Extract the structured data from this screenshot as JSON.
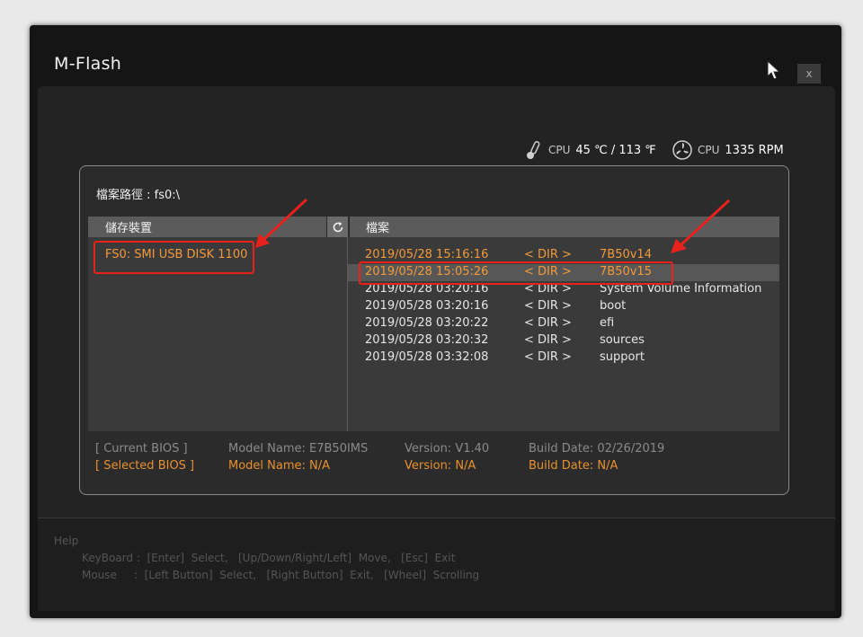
{
  "window": {
    "title": "M-Flash",
    "close_label": "x"
  },
  "status": {
    "cpu_temp_label": "CPU",
    "cpu_temp_value": "45 ℃ / 113 ℉",
    "cpu_fan_label": "CPU",
    "cpu_fan_value": "1335 RPM",
    "icons": [
      "thermometer-icon",
      "fan-icon"
    ]
  },
  "browser": {
    "path_label": "檔案路徑 : fs0:\\",
    "storage_header": "儲存裝置",
    "files_header": "檔案",
    "devices": [
      "FS0: SMI USB DISK 1100"
    ],
    "files": [
      {
        "date": "2019/05/28 15:16:16",
        "type": "< DIR >",
        "name": "7B50v14"
      },
      {
        "date": "2019/05/28 15:05:26",
        "type": "< DIR >",
        "name": "7B50v15"
      },
      {
        "date": "2019/05/28 03:20:16",
        "type": "< DIR >",
        "name": "System Volume Information"
      },
      {
        "date": "2019/05/28 03:20:16",
        "type": "< DIR >",
        "name": "boot"
      },
      {
        "date": "2019/05/28 03:20:22",
        "type": "< DIR >",
        "name": "efi"
      },
      {
        "date": "2019/05/28 03:20:32",
        "type": "< DIR >",
        "name": "sources"
      },
      {
        "date": "2019/05/28 03:32:08",
        "type": "< DIR >",
        "name": "support"
      }
    ]
  },
  "bios": {
    "current": {
      "label": "[ Current BIOS   ]",
      "model": "Model Name: E7B50IMS",
      "version": "Version: V1.40",
      "build": "Build Date: 02/26/2019"
    },
    "selected": {
      "label": "[ Selected BIOS ]",
      "model": "Model Name: N/A",
      "version": "Version: N/A",
      "build": "Build Date: N/A"
    }
  },
  "help": {
    "title": "Help",
    "keyboard": "KeyBoard :  [Enter]  Select,   [Up/Down/Right/Left]  Move,   [Esc]  Exit",
    "mouse": "Mouse     :  [Left Button]  Select,   [Right Button]  Exit,   [Wheel]  Scrolling"
  },
  "colors": {
    "accent": "#f29a3a",
    "annotation": "#e8211b",
    "background": "#151515"
  }
}
